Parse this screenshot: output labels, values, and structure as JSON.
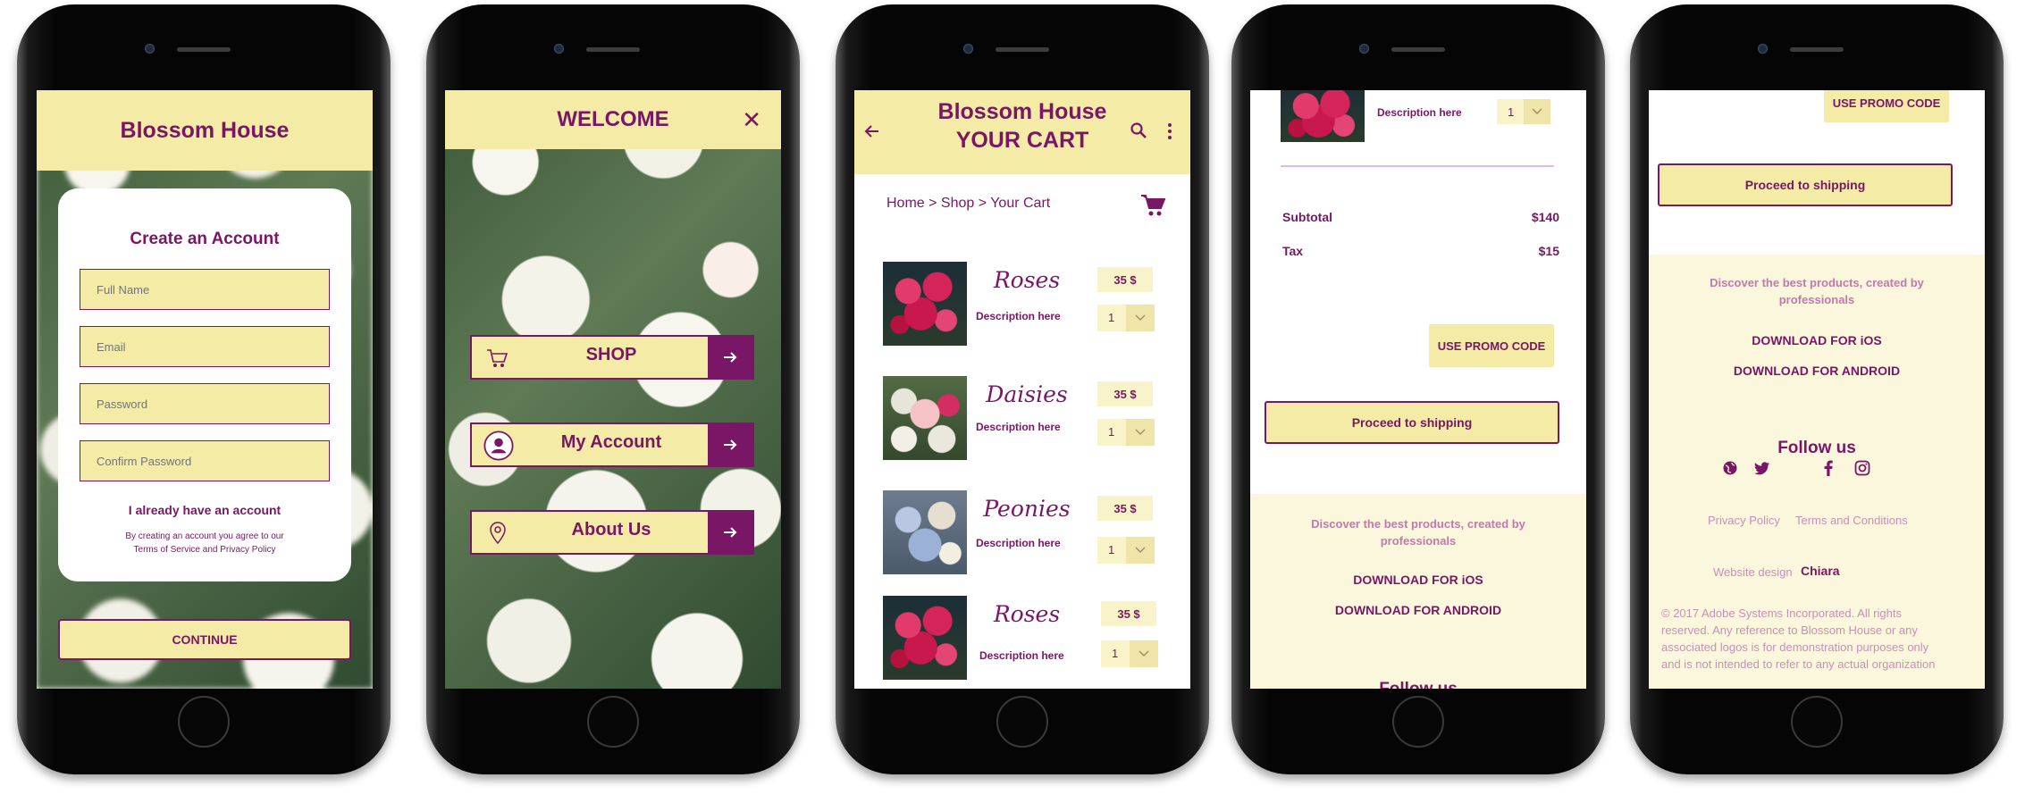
{
  "colors": {
    "accent": "#7a1666",
    "header_yellow": "#f3eba6",
    "footer_bg": "#fbf7dc"
  },
  "screen1": {
    "brand": "Blossom House",
    "title": "Create an Account",
    "fields": [
      {
        "placeholder": "Full Name"
      },
      {
        "placeholder": "Email"
      },
      {
        "placeholder": "Password"
      },
      {
        "placeholder": "Confirm Password"
      }
    ],
    "already": "I already have an account",
    "terms_line1": "By creating an account you agree to our",
    "terms_line2": "Terms of Service and Privacy Policy",
    "continue": "CONTINUE"
  },
  "screen2": {
    "title": "WELCOME",
    "close_icon": "close-icon",
    "items": [
      {
        "label": "SHOP",
        "icon": "cart-icon"
      },
      {
        "label": "My Account",
        "icon": "user-icon"
      },
      {
        "label": "About Us",
        "icon": "location-pin-icon"
      }
    ]
  },
  "screen3": {
    "title_line1": "Blossom House",
    "title_line2": "YOUR CART",
    "breadcrumb": "Home > Shop > Your Cart",
    "products": [
      {
        "name": "Roses",
        "desc": "Description here",
        "price": "35 $",
        "qty": "1"
      },
      {
        "name": "Daisies",
        "desc": "Description here",
        "price": "35 $",
        "qty": "1"
      },
      {
        "name": "Peonies",
        "desc": "Description here",
        "price": "35 $",
        "qty": "1"
      },
      {
        "name": "Roses",
        "desc": "Description here",
        "price": "35 $",
        "qty": "1"
      }
    ]
  },
  "screen4": {
    "item_desc": "Description here",
    "item_qty": "1",
    "subtotal_label": "Subtotal",
    "subtotal": "$140",
    "tax_label": "Tax",
    "tax": "$15",
    "promo": "USE PROMO CODE",
    "shipping": "Proceed to shipping",
    "discover_line1": "Discover the best products, created by",
    "discover_line2": "professionals",
    "download_ios": "DOWNLOAD FOR iOS",
    "download_android": "DOWNLOAD FOR ANDROID",
    "follow_partial": "Follow us"
  },
  "screen5": {
    "promo": "USE PROMO CODE",
    "shipping": "Proceed to shipping",
    "discover_line1": "Discover the best products, created by",
    "discover_line2": "professionals",
    "download_ios": "DOWNLOAD FOR iOS",
    "download_android": "DOWNLOAD FOR ANDROID",
    "follow": "Follow us",
    "privacy": "Privacy Policy",
    "terms": "Terms and Conditions",
    "design_label": "Website design",
    "designer": "Chiara",
    "copyright_l1": "© 2017 Adobe Systems Incorporated. All rights",
    "copyright_l2": "reserved. Any reference to Blossom House or any",
    "copyright_l3": "associated logos is for demonstration purposes only",
    "copyright_l4": "and is not intended to refer to any actual organization"
  }
}
